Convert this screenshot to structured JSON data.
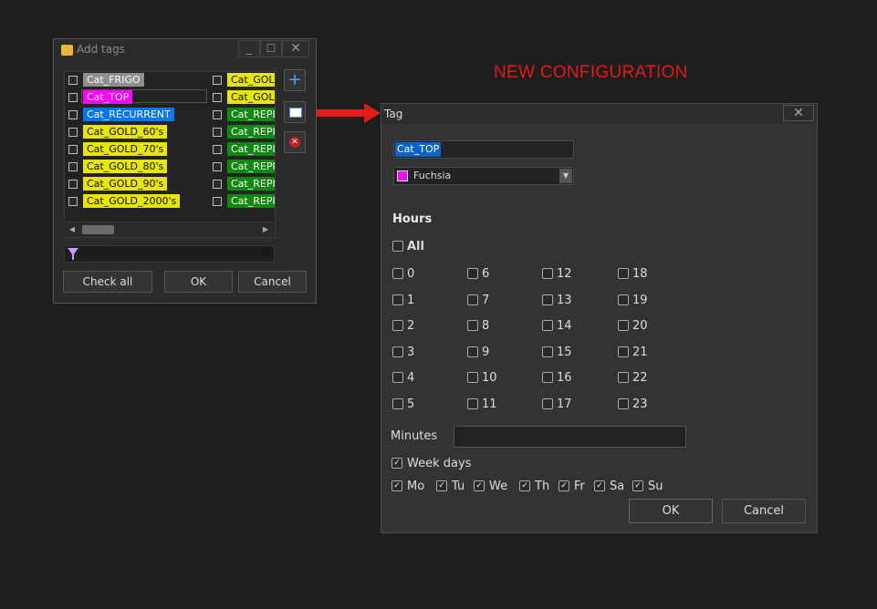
{
  "add_tags": {
    "title": "Add tags",
    "win_min": "_",
    "win_max": "☐",
    "win_close": "✕",
    "tags_col1": [
      {
        "label": "Cat_FRIGO",
        "color": "#8e8e8e"
      },
      {
        "label": "Cat_TOP",
        "color": "#ff00ff"
      },
      {
        "label": "Cat_RÉCURRENT",
        "color": "#0077e6"
      },
      {
        "label": "Cat_GOLD_60's",
        "color": "#e6e600"
      },
      {
        "label": "Cat_GOLD_70's",
        "color": "#e6e600"
      },
      {
        "label": "Cat_GOLD_80's",
        "color": "#e6e600"
      },
      {
        "label": "Cat_GOLD_90's",
        "color": "#e6e600"
      },
      {
        "label": "Cat_GOLD_2000's",
        "color": "#e6e600"
      }
    ],
    "tags_col2": [
      {
        "label": "Cat_GOL",
        "color": "#e6e600"
      },
      {
        "label": "Cat_GOL",
        "color": "#e6e600"
      },
      {
        "label": "Cat_REPI",
        "color": "#118811"
      },
      {
        "label": "Cat_REPI",
        "color": "#118811"
      },
      {
        "label": "Cat_REPI",
        "color": "#118811"
      },
      {
        "label": "Cat_REPI",
        "color": "#118811"
      },
      {
        "label": "Cat_REPI",
        "color": "#118811"
      },
      {
        "label": "Cat_REPI",
        "color": "#118811"
      }
    ],
    "add_symbol": "+",
    "remove_symbol": "✕",
    "filter_clear": "✕",
    "scroll_left": "◀",
    "scroll_right": "▶",
    "check_all": "Check all",
    "ok": "OK",
    "cancel": "Cancel"
  },
  "heading": "NEW CONFIGURATION",
  "tag_dialog": {
    "title": "Tag",
    "close": "✕",
    "name_value": "Cat_TOP",
    "color_value": "Fuchsia",
    "color_hex": "#ff00ff",
    "color_arrow": "▼",
    "hours_title": "Hours",
    "all_label": "All",
    "hours": [
      "0",
      "1",
      "2",
      "3",
      "4",
      "5",
      "6",
      "7",
      "8",
      "9",
      "10",
      "11",
      "12",
      "13",
      "14",
      "15",
      "16",
      "17",
      "18",
      "19",
      "20",
      "21",
      "22",
      "23"
    ],
    "minutes_label": "Minutes",
    "minutes_value": "",
    "week_days_label": "Week days",
    "week_days_checked": true,
    "days": [
      {
        "label": "Mo",
        "checked": true
      },
      {
        "label": "Tu",
        "checked": true
      },
      {
        "label": "We",
        "checked": true
      },
      {
        "label": "Th",
        "checked": true
      },
      {
        "label": "Fr",
        "checked": true
      },
      {
        "label": "Sa",
        "checked": true
      },
      {
        "label": "Su",
        "checked": true
      }
    ],
    "check_mark": "✓",
    "ok": "OK",
    "cancel": "Cancel"
  },
  "colors": {
    "accent_red": "#e31b1b",
    "selection_blue": "#0a64c8"
  }
}
